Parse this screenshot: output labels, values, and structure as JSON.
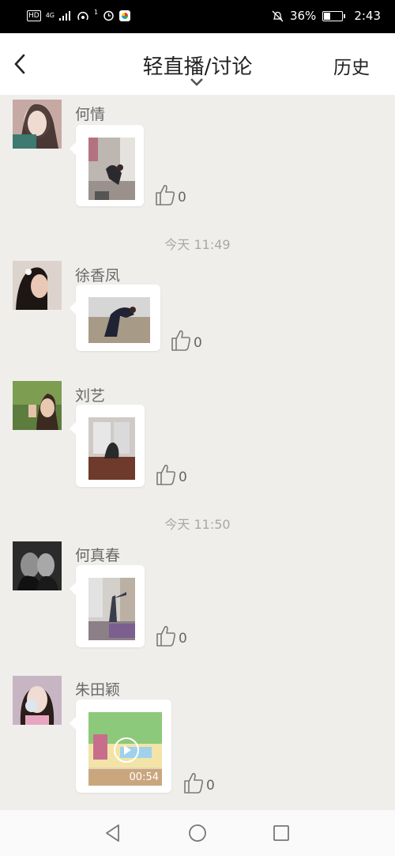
{
  "status_bar": {
    "network_type": "4G",
    "hd": "HD",
    "notification_count": "1",
    "battery": "36%",
    "time": "2:43"
  },
  "header": {
    "title": "轻直播/讨论",
    "history_label": "历史"
  },
  "feed": {
    "posts": [
      {
        "name": "何情",
        "likes": "0"
      },
      {
        "name": "徐香凤",
        "likes": "0"
      },
      {
        "name": "刘艺",
        "likes": "0"
      },
      {
        "name": "何真春",
        "likes": "0"
      },
      {
        "name": "朱田颖",
        "likes": "0",
        "video_duration": "00:54"
      }
    ],
    "timestamps": [
      "今天 11:49",
      "今天 11:50"
    ]
  },
  "icons": {
    "back": "chevron-left-icon",
    "expand": "chevron-down-icon",
    "like": "thumbs-up-icon",
    "play": "play-icon",
    "nav_back": "triangle-back-icon",
    "nav_home": "circle-home-icon",
    "nav_recent": "square-recent-icon"
  },
  "colors": {
    "background": "#efeeeb",
    "header_bg": "#ffffff",
    "status_bar_bg": "#000000",
    "name_text": "#6a6a6a",
    "timestamp_text": "#a8a8a8"
  }
}
